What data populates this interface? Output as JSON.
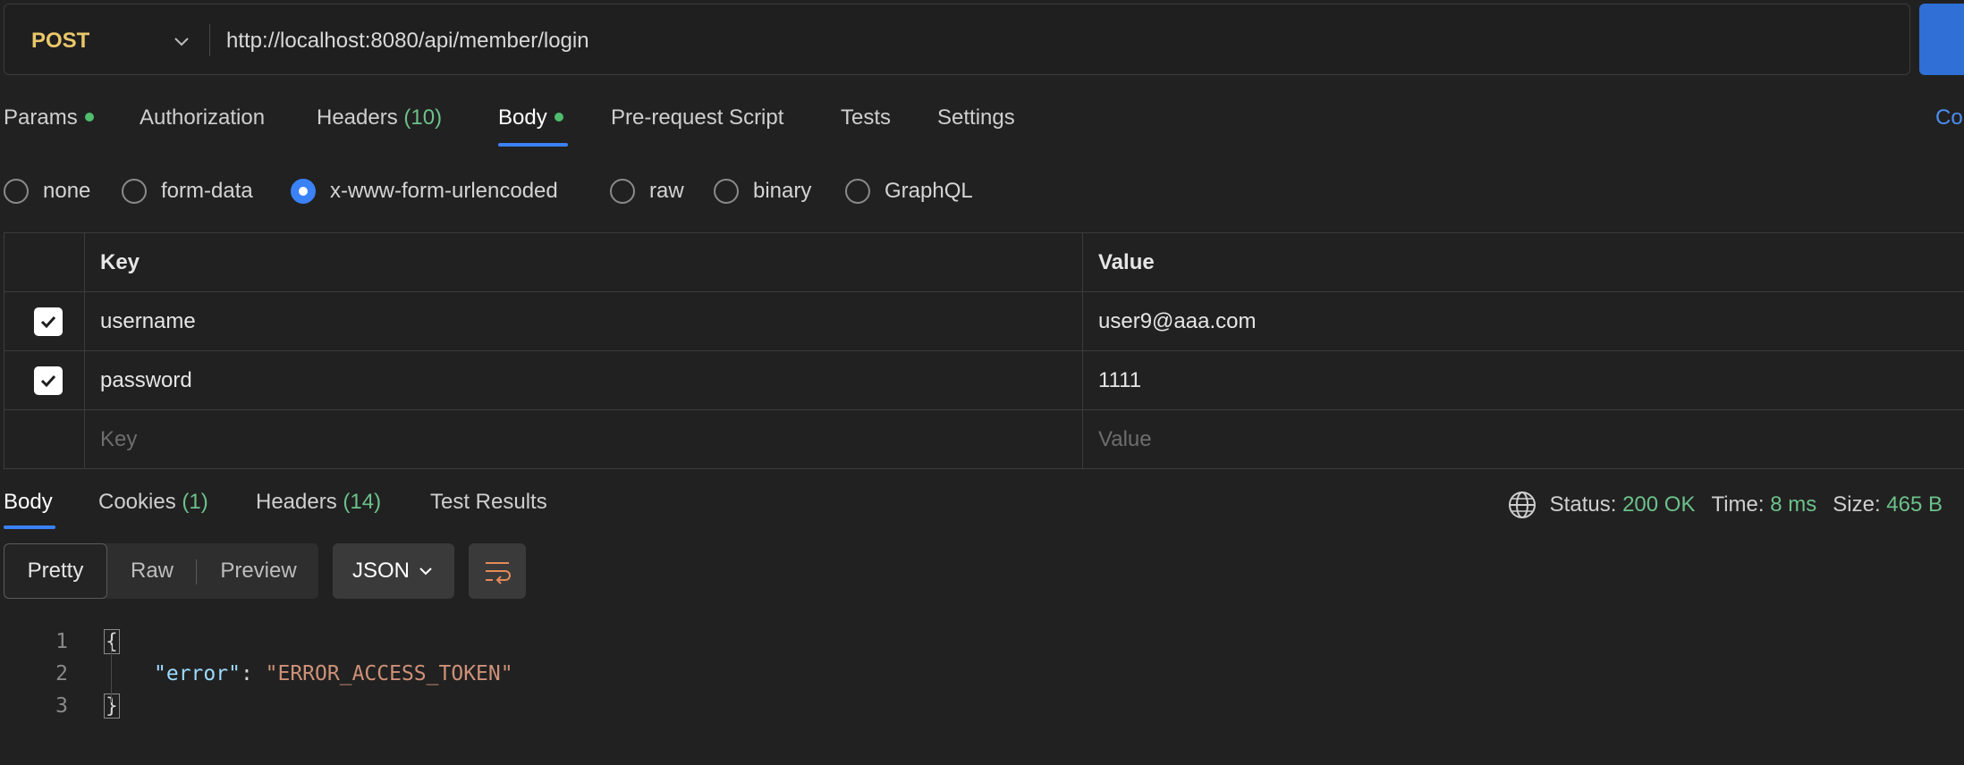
{
  "request": {
    "method": "POST",
    "url": "http://localhost:8080/api/member/login"
  },
  "request_tabs": [
    {
      "label": "Params",
      "count": "",
      "dot": true
    },
    {
      "label": "Authorization",
      "count": "",
      "dot": false
    },
    {
      "label": "Headers",
      "count": "(10)",
      "dot": false
    },
    {
      "label": "Body",
      "count": "",
      "dot": true,
      "active": true
    },
    {
      "label": "Pre-request Script",
      "count": "",
      "dot": false
    },
    {
      "label": "Tests",
      "count": "",
      "dot": false
    },
    {
      "label": "Settings",
      "count": "",
      "dot": false
    }
  ],
  "cookies_link": "Co",
  "body_types": [
    {
      "label": "none",
      "selected": false
    },
    {
      "label": "form-data",
      "selected": false
    },
    {
      "label": "x-www-form-urlencoded",
      "selected": true
    },
    {
      "label": "raw",
      "selected": false
    },
    {
      "label": "binary",
      "selected": false
    },
    {
      "label": "GraphQL",
      "selected": false
    }
  ],
  "kv_table": {
    "headers": {
      "key": "Key",
      "value": "Value"
    },
    "rows": [
      {
        "checked": true,
        "key": "username",
        "value": "user9@aaa.com"
      },
      {
        "checked": true,
        "key": "password",
        "value": "1111"
      }
    ],
    "placeholder": {
      "key": "Key",
      "value": "Value"
    }
  },
  "response_tabs": [
    {
      "label": "Body",
      "count": "",
      "active": true
    },
    {
      "label": "Cookies",
      "count": "(1)"
    },
    {
      "label": "Headers",
      "count": "(14)"
    },
    {
      "label": "Test Results",
      "count": ""
    }
  ],
  "status": {
    "status_label": "Status:",
    "status_value": "200 OK",
    "time_label": "Time:",
    "time_value": "8 ms",
    "size_label": "Size:",
    "size_value": "465 B"
  },
  "view_modes": {
    "pretty": "Pretty",
    "raw": "Raw",
    "preview": "Preview"
  },
  "format_select": "JSON",
  "code": {
    "line_numbers": [
      "1",
      "2",
      "3"
    ],
    "open_brace": "{",
    "key": "\"error\"",
    "colon": ": ",
    "value": "\"ERROR_ACCESS_TOKEN\"",
    "close_brace": "}"
  },
  "colors": {
    "accent": "#3b82f6",
    "method": "#e9c76a",
    "success": "#6cc18a",
    "json_key": "#9cdcfe",
    "json_string": "#ce9178"
  }
}
